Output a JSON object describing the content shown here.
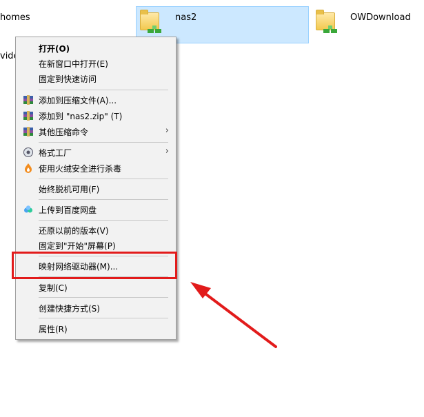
{
  "explorer": {
    "items": [
      {
        "label": "homes"
      },
      {
        "label": "nas2"
      },
      {
        "label": "OWDownload"
      },
      {
        "label": "vide"
      }
    ]
  },
  "context_menu": {
    "groups": [
      [
        {
          "label": "打开(O)",
          "bold": true
        },
        {
          "label": "在新窗口中打开(E)"
        },
        {
          "label": "固定到快速访问"
        }
      ],
      [
        {
          "label": "添加到压缩文件(A)...",
          "icon": "winrar-icon"
        },
        {
          "label": "添加到 \"nas2.zip\" (T)",
          "icon": "winrar-icon"
        },
        {
          "label": "其他压缩命令",
          "icon": "winrar-icon",
          "submenu": true
        }
      ],
      [
        {
          "label": "格式工厂",
          "icon": "format-factory-icon",
          "submenu": true
        },
        {
          "label": "使用火绒安全进行杀毒",
          "icon": "huorong-icon"
        }
      ],
      [
        {
          "label": "始终脱机可用(F)"
        }
      ],
      [
        {
          "label": "上传到百度网盘",
          "icon": "baidu-netdisk-icon"
        }
      ],
      [
        {
          "label": "还原以前的版本(V)"
        },
        {
          "label": "固定到\"开始\"屏幕(P)"
        }
      ],
      [
        {
          "label": "映射网络驱动器(M)..."
        }
      ],
      [
        {
          "label": "复制(C)"
        }
      ],
      [
        {
          "label": "创建快捷方式(S)"
        }
      ],
      [
        {
          "label": "属性(R)"
        }
      ]
    ]
  },
  "annotation": {
    "color": "#e21b1b"
  }
}
